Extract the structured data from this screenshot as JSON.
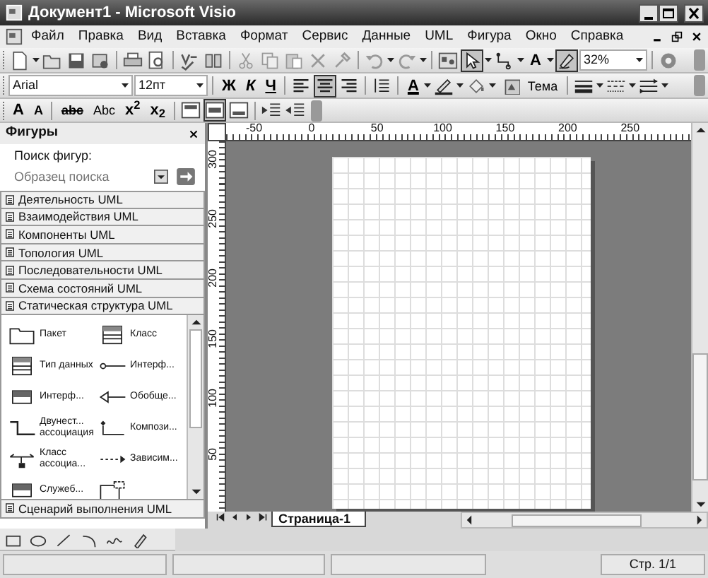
{
  "window": {
    "title": "Документ1 - Microsoft Visio"
  },
  "menu": [
    "Файл",
    "Правка",
    "Вид",
    "Вставка",
    "Формат",
    "Сервис",
    "Данные",
    "UML",
    "Фигура",
    "Окно",
    "Справка"
  ],
  "standard_toolbar": {
    "tools": [
      {
        "kind": "pointer",
        "selected": true
      },
      {
        "kind": "connector",
        "selected": false
      },
      {
        "kind": "text",
        "label": "A",
        "selected": false
      }
    ],
    "ink_on": true,
    "zoom": "32%"
  },
  "formatting_toolbar": {
    "font": "Arial",
    "font_size": "12пт",
    "bold": "Ж",
    "italic": "К",
    "underline": "Ч",
    "alignment": [
      {
        "selected": false
      },
      {
        "selected": true
      },
      {
        "selected": false
      }
    ],
    "font_color": "A",
    "theme": "Тема"
  },
  "text_toolbar": {
    "grow": "A",
    "shrink": "A",
    "strikethrough": "abc",
    "small_caps": "Abc",
    "superscript": "x$^{2}$",
    "subscript": "x$_{2}$",
    "vertical_alignment": [
      {
        "selected": false
      },
      {
        "selected": true
      },
      {
        "selected": false
      }
    ]
  },
  "shapes_panel": {
    "title": "Фигуры",
    "search_label": "Поиск фигур:",
    "search_placeholder": "Образец поиска",
    "stencils": [
      {
        "label": "Деятельность UML"
      },
      {
        "label": "Взаимодействия UML"
      },
      {
        "label": "Компоненты UML"
      },
      {
        "label": "Топология UML"
      },
      {
        "label": "Последовательности UML"
      },
      {
        "label": "Схема состояний UML"
      },
      {
        "label": "Статическая структура UML",
        "shapes": [
          {
            "label": "Пакет",
            "kind": "package"
          },
          {
            "label": "Класс",
            "kind": "class"
          },
          {
            "label": "Тип данных",
            "kind": "class"
          },
          {
            "label": "Интерф...",
            "kind": "lollipop"
          },
          {
            "label": "Интерф...",
            "kind": "interface"
          },
          {
            "label": "Обобще...",
            "kind": "generalization"
          },
          {
            "label": "Двунест... ассоциация",
            "kind": "association"
          },
          {
            "label": "Компози...",
            "kind": "composition"
          },
          {
            "label": "Класс ассоциа...",
            "kind": "association-class"
          },
          {
            "label": "Зависим...",
            "kind": "dependency"
          },
          {
            "label": "Служеб...",
            "kind": "interface"
          },
          {
            "kind": "template"
          }
        ]
      },
      {
        "label": "Сценарий выполнения UML"
      }
    ]
  },
  "rulers": {
    "horizontal": [
      "-50",
      "0",
      "50",
      "100",
      "150",
      "200",
      "250"
    ],
    "vertical": [
      "300",
      "250",
      "200",
      "150",
      "100",
      "50"
    ]
  },
  "page_tabs": [
    {
      "label": "Страница-1",
      "selected": true
    }
  ],
  "status_bar": {
    "page": "Стр. 1/1"
  }
}
